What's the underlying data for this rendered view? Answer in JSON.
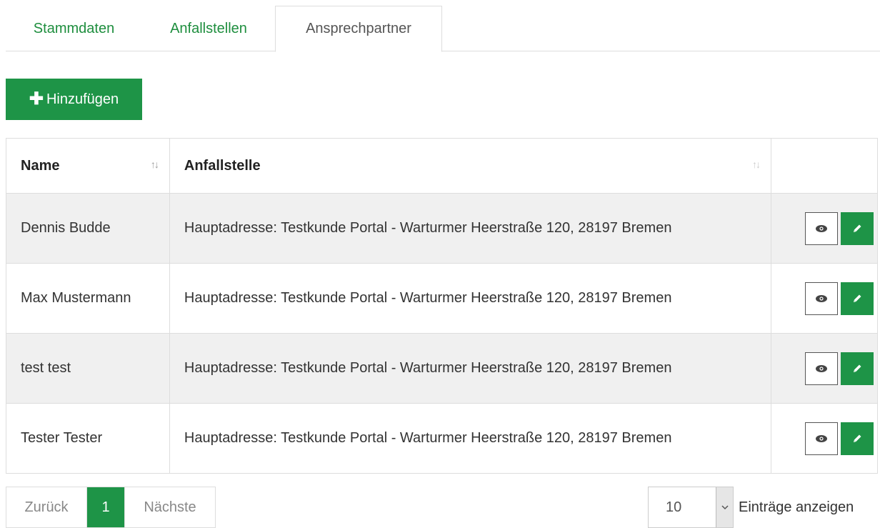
{
  "tabs": [
    {
      "label": "Stammdaten",
      "active": false
    },
    {
      "label": "Anfallstellen",
      "active": false
    },
    {
      "label": "Ansprechpartner",
      "active": true
    }
  ],
  "add_button": {
    "label": "Hinzufügen",
    "icon": "plus-icon"
  },
  "table": {
    "columns": [
      {
        "label": "Name",
        "sortable": true
      },
      {
        "label": "Anfallstelle",
        "sortable": true
      },
      {
        "label": "",
        "sortable": false
      }
    ],
    "rows": [
      {
        "name": "Dennis Budde",
        "anfallstelle": "Hauptadresse: Testkunde Portal - Warturmer Heerstraße 120, 28197 Bremen"
      },
      {
        "name": "Max Mustermann",
        "anfallstelle": "Hauptadresse: Testkunde Portal - Warturmer Heerstraße 120, 28197 Bremen"
      },
      {
        "name": "test test",
        "anfallstelle": "Hauptadresse: Testkunde Portal - Warturmer Heerstraße 120, 28197 Bremen"
      },
      {
        "name": "Tester Tester",
        "anfallstelle": "Hauptadresse: Testkunde Portal - Warturmer Heerstraße 120, 28197 Bremen"
      }
    ],
    "row_actions": [
      "eye-icon",
      "pencil-icon"
    ]
  },
  "pagination": {
    "prev": "Zurück",
    "current": "1",
    "next": "Nächste"
  },
  "page_length": {
    "value": "10",
    "label": "Einträge anzeigen"
  },
  "colors": {
    "accent": "#1e9447",
    "tab_text": "#1e8e3e",
    "row_stripe": "#f0f0f0",
    "border": "#dddddd"
  }
}
